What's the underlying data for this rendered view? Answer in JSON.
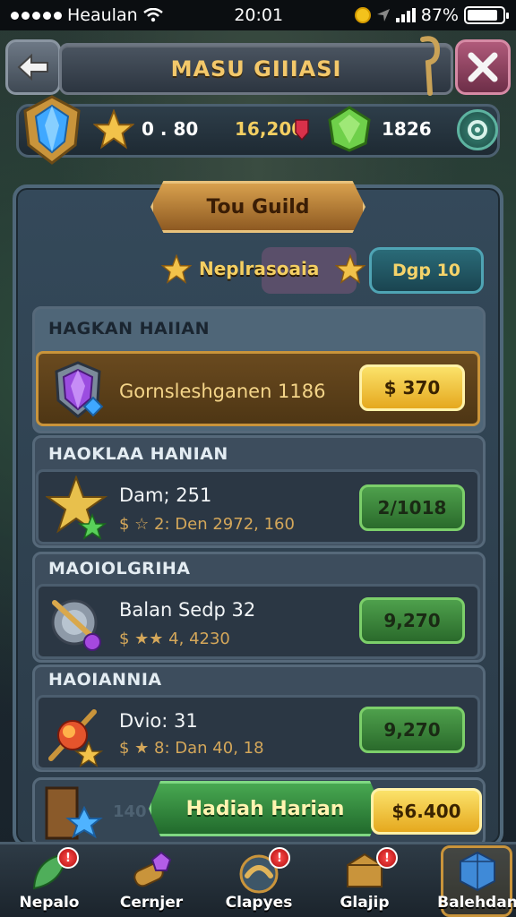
{
  "status_bar": {
    "carrier": "Heaulan",
    "time": "20:01",
    "battery": "87%",
    "battery_level": 0.87
  },
  "header": {
    "title": "MASU GIIIASI"
  },
  "resources": {
    "stars": "0 . 80",
    "gold": "16,200",
    "gems": "1826"
  },
  "guild": {
    "plate_label": "Tou Guild",
    "name": "Neplrasoaia",
    "rank": "Dgp 10"
  },
  "sections": [
    {
      "title": "HAGKAN HAIIAN",
      "item": {
        "title": "Gornsleshganen 1186",
        "sub": "",
        "price": "$ 370",
        "price_style": "yellow"
      }
    },
    {
      "title": "HAOKLAA HANIAN",
      "item": {
        "title": "Dam; 251",
        "sub": "$ ☆ 2: Den 2972, 160",
        "price": "2/1018",
        "price_style": "green"
      }
    },
    {
      "title": "MAOIOLGRIHA",
      "item": {
        "title": "Balan Sedp 32",
        "sub": "$ ★★ 4, 4230",
        "price": "9,270",
        "price_style": "green"
      }
    },
    {
      "title": "HAOIANNIA",
      "item": {
        "title": "Dvio: 31",
        "sub": "$ ★ 8: Dan 40, 18",
        "price": "9,270",
        "price_style": "green"
      }
    }
  ],
  "daily": {
    "button_label": "Hadiah Harian",
    "price": "$6.400",
    "hint": "140"
  },
  "bottom_nav": {
    "items": [
      {
        "label": "Nepalo",
        "icon": "leaf-icon",
        "badge": "!"
      },
      {
        "label": "Cernjer",
        "icon": "scroll-gem-icon",
        "badge": ""
      },
      {
        "label": "Clapyes",
        "icon": "horn-icon",
        "badge": "!"
      },
      {
        "label": "Glajip",
        "icon": "chest-icon",
        "badge": "!"
      },
      {
        "label": "Balehdan",
        "icon": "dice-icon",
        "badge": ""
      }
    ]
  },
  "colors": {
    "accent_gold": "#f4cf62",
    "button_green": "#4ea04c",
    "button_yellow": "#fbe26a",
    "frame": "#34495a"
  }
}
